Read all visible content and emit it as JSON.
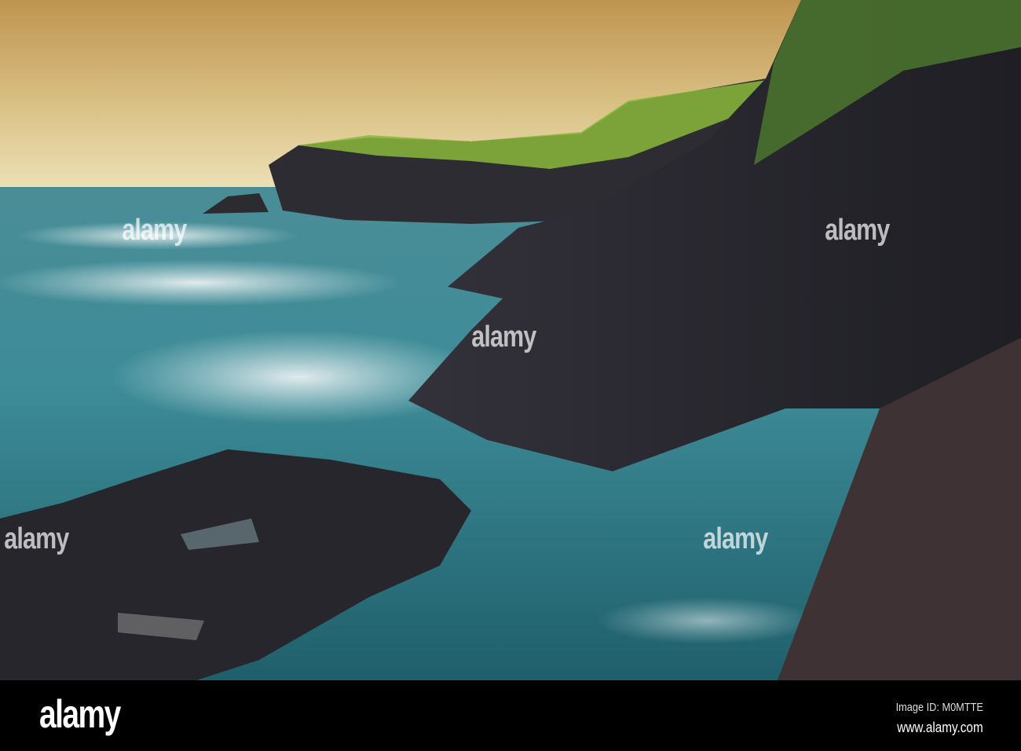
{
  "photo": {
    "subject": "rocky coastal cliffs with long-exposure sea",
    "colors": {
      "sky_top": "#c49a55",
      "sky_horizon": "#e9dcae",
      "sea": "#2f7b88",
      "rock": "#2a2a30",
      "grass": "#8fbf3a"
    }
  },
  "watermark": {
    "text": "alamy"
  },
  "footer": {
    "logo": "alamy",
    "image_id": "Image ID: M0MTTE",
    "website": "www.alamy.com"
  }
}
